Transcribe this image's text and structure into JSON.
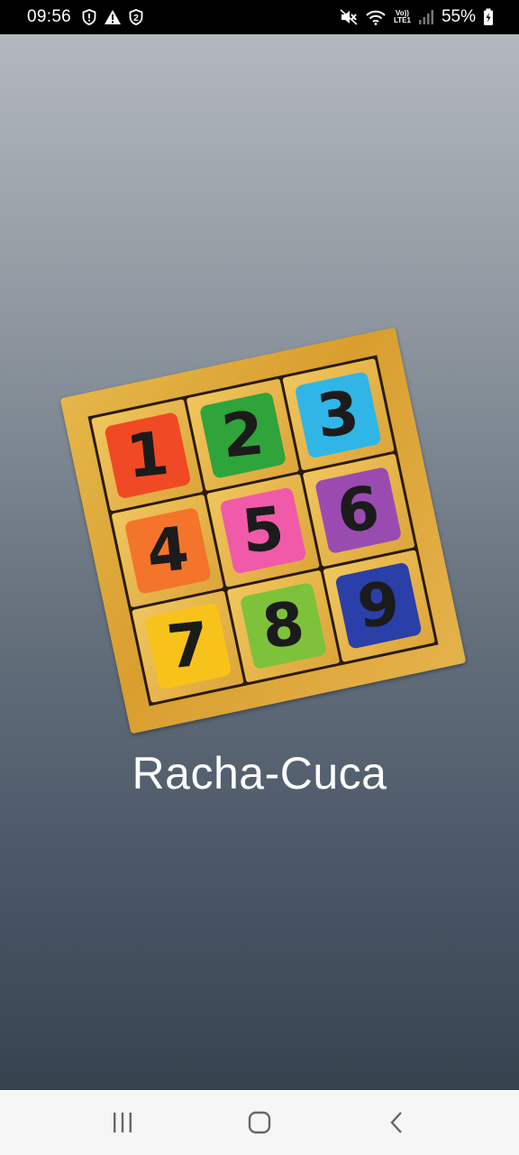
{
  "status_bar": {
    "time": "09:56",
    "battery": "55%",
    "lte_top": "Vo))",
    "lte_bottom": "LTE1",
    "icons": [
      "shield-alert-icon",
      "warning-icon",
      "shield-2-icon",
      "mute-icon",
      "wifi-icon",
      "signal-icon",
      "battery-charging-icon"
    ]
  },
  "splash": {
    "app_title": "Racha-Cuca",
    "puzzle_tiles": [
      {
        "label": "1",
        "color": "#f04a24"
      },
      {
        "label": "2",
        "color": "#2fa43a"
      },
      {
        "label": "3",
        "color": "#2fb6e6"
      },
      {
        "label": "4",
        "color": "#f3742a"
      },
      {
        "label": "5",
        "color": "#f05aa8"
      },
      {
        "label": "6",
        "color": "#9a4bb0"
      },
      {
        "label": "7",
        "color": "#f7c31a"
      },
      {
        "label": "8",
        "color": "#7dc23a"
      },
      {
        "label": "9",
        "color": "#2b3fa8"
      }
    ]
  },
  "nav_bar": {
    "buttons": [
      "recent-apps",
      "home",
      "back"
    ]
  },
  "colors": {
    "gradient_top": "#b3b8be",
    "gradient_bottom": "#36434f",
    "title_text": "#ffffff",
    "board_wood": "#dca53a"
  }
}
